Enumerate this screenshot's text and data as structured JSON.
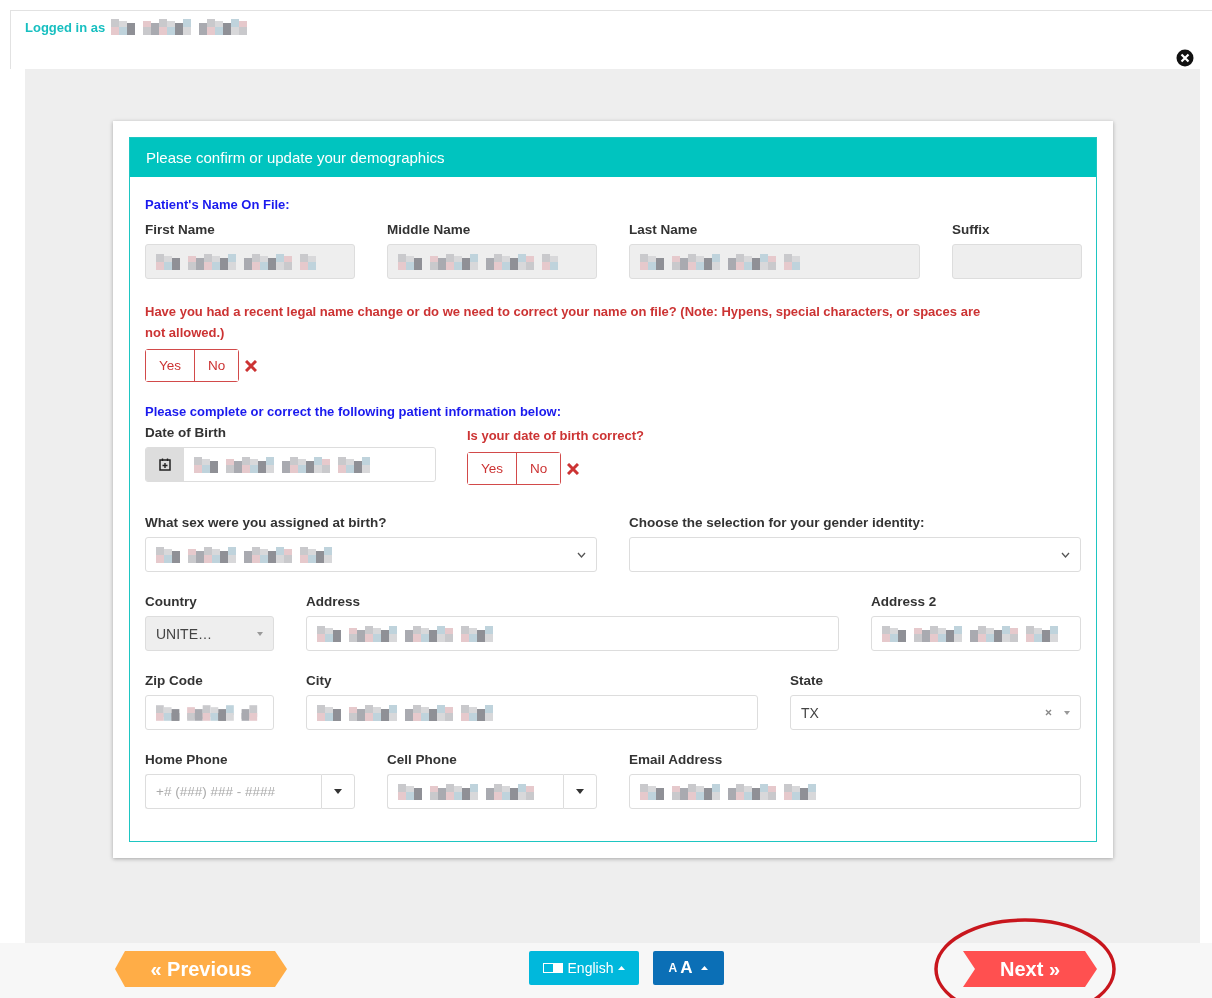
{
  "header": {
    "logged_in_label": "Logged in as",
    "user_redacted": true
  },
  "form": {
    "title": "Please confirm or update your demographics",
    "name_section": "Patient's Name On File:",
    "name_fields": [
      {
        "label": "First Name",
        "redacted": true
      },
      {
        "label": "Middle Name",
        "redacted": true
      },
      {
        "label": "Last Name",
        "redacted": true
      },
      {
        "label": "Suffix",
        "redacted": false
      }
    ],
    "name_change": {
      "question": "Have you had a recent legal name change or do we need to correct your name on file? (Note: Hypens, special characters, or spaces are not allowed.)",
      "options": [
        {
          "label": "Yes",
          "selected": false
        },
        {
          "label": "No",
          "selected": false
        }
      ],
      "invalid": true
    },
    "info_section": "Please complete or correct the following patient information below:",
    "dob": {
      "label": "Date of Birth",
      "redacted": true
    },
    "dob_check": {
      "question": "Is your date of birth correct?",
      "options": [
        {
          "label": "Yes",
          "selected": false
        },
        {
          "label": "No",
          "selected": false
        }
      ],
      "invalid": true
    },
    "sex": {
      "label": "What sex were you assigned at birth?",
      "redacted": true
    },
    "gender": {
      "label": "Choose the selection for your gender identity:",
      "redacted": false
    },
    "country": {
      "label": "Country",
      "value": "UNITE…"
    },
    "address": {
      "label": "Address",
      "redacted": true
    },
    "address2": {
      "label": "Address 2",
      "redacted": true
    },
    "zip": {
      "label": "Zip Code",
      "redacted": true
    },
    "city": {
      "label": "City",
      "redacted": true
    },
    "state": {
      "label": "State",
      "value": "TX"
    },
    "home_phone": {
      "label": "Home Phone",
      "placeholder": "+# (###) ### - ####"
    },
    "cell_phone": {
      "label": "Cell Phone",
      "redacted": true
    },
    "email": {
      "label": "Email Address",
      "redacted": true
    }
  },
  "footer": {
    "previous": "« Previous",
    "language": "English",
    "font_size": [
      "A",
      "A"
    ],
    "next": {
      "label": "Next »",
      "circled": true
    }
  }
}
